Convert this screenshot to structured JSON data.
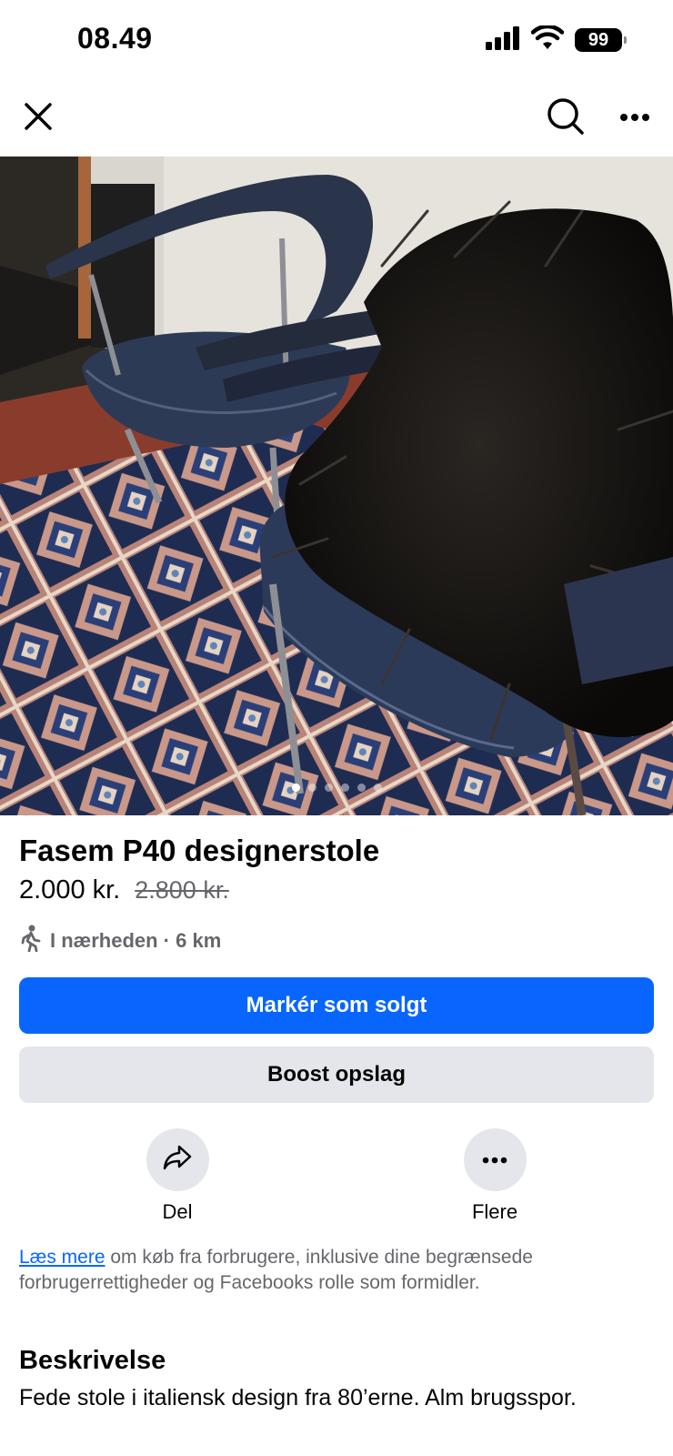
{
  "status_bar": {
    "time": "08.49",
    "battery": "99"
  },
  "nav": {
    "close_icon": "close-icon",
    "search_icon": "search-icon",
    "more_icon": "more-icon"
  },
  "photo": {
    "description_icon": "listing-photo",
    "total_images": 6,
    "active_index": 0
  },
  "listing": {
    "title": "Fasem P40 designerstole",
    "price": "2.000 kr.",
    "old_price": "2.800 kr.",
    "location": "I nærheden · 6 km"
  },
  "buttons": {
    "mark_sold": "Markér som solgt",
    "boost": "Boost opslag"
  },
  "actions": {
    "share_label": "Del",
    "more_label": "Flere"
  },
  "legal": {
    "link": "Læs mere",
    "text": " om køb fra forbrugere, inklusive dine begrænsede forbrugerrettigheder og Facebooks rolle som formidler."
  },
  "description": {
    "heading": "Beskrivelse",
    "text": "Fede stole i italiensk design fra 80’erne. Alm brugsspor."
  },
  "colors": {
    "primary": "#0866ff",
    "secondary_bg": "#e4e6eb",
    "muted_text": "#65676b"
  }
}
